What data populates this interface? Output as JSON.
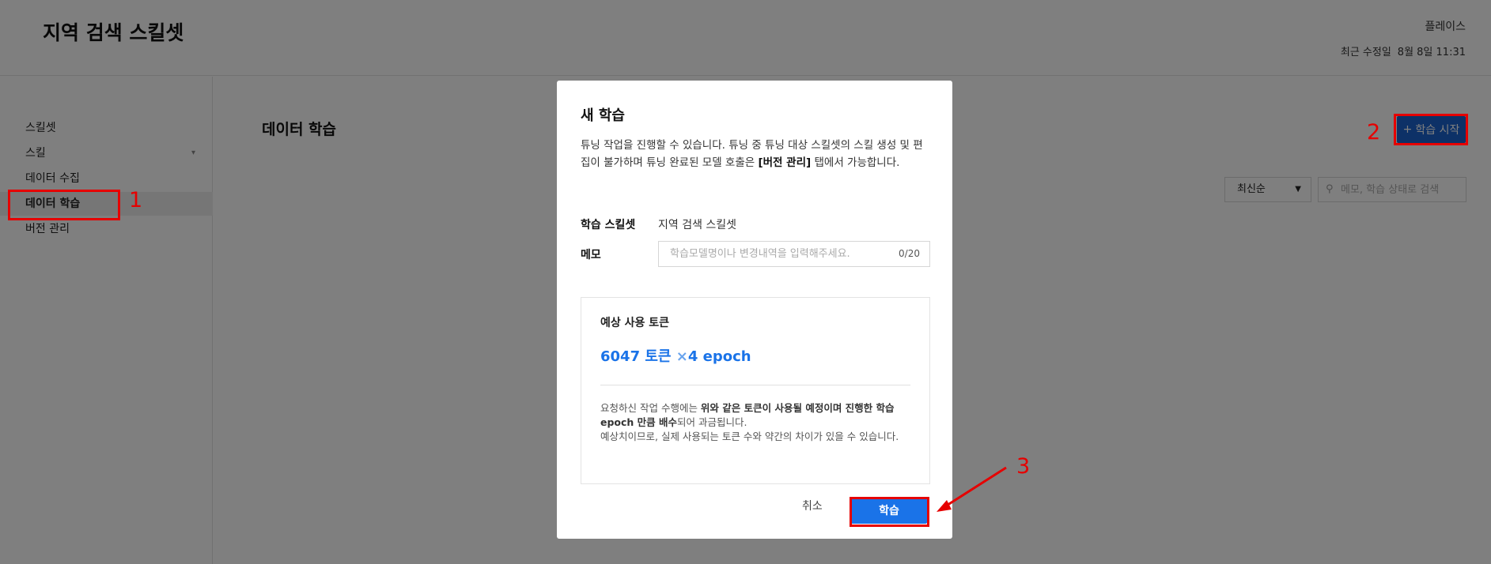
{
  "header": {
    "title": "지역 검색 스킬셋",
    "workspace": "플레이스",
    "modified_label": "최근 수정일",
    "modified_value": "8월 8일 11:31"
  },
  "sidebar": {
    "items": [
      {
        "label": "스킬셋"
      },
      {
        "label": "스킬"
      },
      {
        "label": "데이터 수집"
      },
      {
        "label": "데이터 학습"
      },
      {
        "label": "버전 관리"
      }
    ]
  },
  "main": {
    "title": "데이터 학습",
    "start_button": "학습 시작",
    "sort_selected": "최신순",
    "search_placeholder": "메모, 학습 상태로 검색"
  },
  "modal": {
    "title": "새 학습",
    "desc_1": "튜닝 작업을 진행할 수 있습니다. 튜닝 중 튜닝 대상 스킬셋의 스킬 생성 및 편집이 불가하며 튜닝 완료된 모델 호출은 ",
    "desc_bold": "[버전 관리]",
    "desc_2": " 탭에서 가능합니다.",
    "skillset_label": "학습 스킬셋",
    "skillset_value": "지역 검색 스킬셋",
    "memo_label": "메모",
    "memo_placeholder": "학습모델명이나 변경내역을 입력해주세요.",
    "memo_count": "0/20",
    "token_title": "예상 사용 토큰",
    "token_value": "6047 토큰",
    "token_times": "×",
    "token_epoch": "4 epoch",
    "note_1": "요청하신 작업 수행에는 ",
    "note_bold_1": "위와 같은 토큰이 사용될 예정이며 진행한 학습 epoch 만큼 배수",
    "note_2": "되어 과금됩니다.",
    "note_3": "예상치이므로, 실제 사용되는 토큰 수와 약간의 차이가 있을 수 있습니다.",
    "cancel": "취소",
    "submit": "학습"
  },
  "annotations": [
    "1",
    "2",
    "3"
  ],
  "colors": {
    "primary": "#1a73e8",
    "start_button": "#1b63ce",
    "annotation": "#e60000",
    "overlay": "rgba(0,0,0,0.5)"
  }
}
